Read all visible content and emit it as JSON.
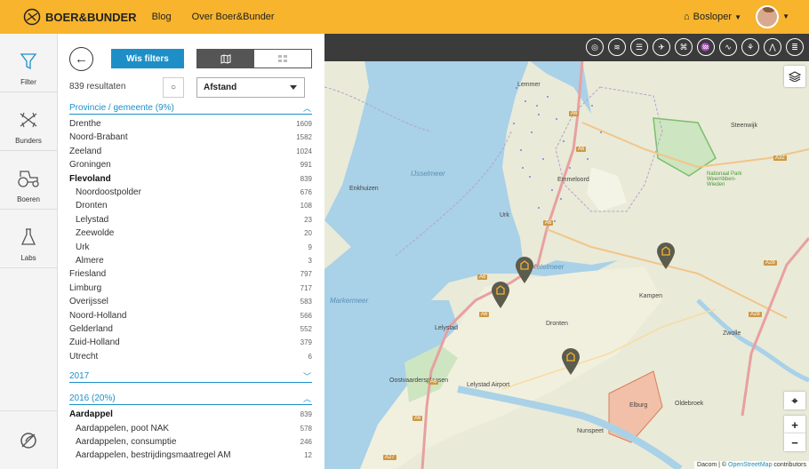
{
  "header": {
    "logo_text": "BOER&BUNDER",
    "nav": [
      "Blog",
      "Over Boer&Bunder"
    ],
    "user_name": "Bosloper"
  },
  "sidebar": {
    "items": [
      {
        "label": "Filter",
        "icon": "filter-icon"
      },
      {
        "label": "Bunders",
        "icon": "bunders-icon"
      },
      {
        "label": "Boeren",
        "icon": "tractor-icon"
      },
      {
        "label": "Labs",
        "icon": "flask-icon"
      }
    ]
  },
  "filters": {
    "clear_label": "Wis filters",
    "results": "839 resultaten",
    "sort_button": "○",
    "sort_value": "Afstand",
    "sections": [
      {
        "title": "Provincie / gemeente (9%)",
        "expanded": true,
        "rows": [
          {
            "label": "Drenthe",
            "count": "1609",
            "sub": false,
            "bold": false
          },
          {
            "label": "Noord-Brabant",
            "count": "1582",
            "sub": false,
            "bold": false
          },
          {
            "label": "Zeeland",
            "count": "1024",
            "sub": false,
            "bold": false
          },
          {
            "label": "Groningen",
            "count": "991",
            "sub": false,
            "bold": false
          },
          {
            "label": "Flevoland",
            "count": "839",
            "sub": false,
            "bold": true
          },
          {
            "label": "Noordoostpolder",
            "count": "676",
            "sub": true,
            "bold": false
          },
          {
            "label": "Dronten",
            "count": "108",
            "sub": true,
            "bold": false
          },
          {
            "label": "Lelystad",
            "count": "23",
            "sub": true,
            "bold": false
          },
          {
            "label": "Zeewolde",
            "count": "20",
            "sub": true,
            "bold": false
          },
          {
            "label": "Urk",
            "count": "9",
            "sub": true,
            "bold": false
          },
          {
            "label": "Almere",
            "count": "3",
            "sub": true,
            "bold": false
          },
          {
            "label": "Friesland",
            "count": "797",
            "sub": false,
            "bold": false
          },
          {
            "label": "Limburg",
            "count": "717",
            "sub": false,
            "bold": false
          },
          {
            "label": "Overijssel",
            "count": "583",
            "sub": false,
            "bold": false
          },
          {
            "label": "Noord-Holland",
            "count": "566",
            "sub": false,
            "bold": false
          },
          {
            "label": "Gelderland",
            "count": "552",
            "sub": false,
            "bold": false
          },
          {
            "label": "Zuid-Holland",
            "count": "379",
            "sub": false,
            "bold": false
          },
          {
            "label": "Utrecht",
            "count": "6",
            "sub": false,
            "bold": false
          }
        ]
      },
      {
        "title": "2017",
        "expanded": false,
        "rows": []
      },
      {
        "title": "2016 (20%)",
        "expanded": true,
        "rows": [
          {
            "label": "Aardappel",
            "count": "839",
            "sub": false,
            "bold": true
          },
          {
            "label": "Aardappelen, poot NAK",
            "count": "578",
            "sub": true,
            "bold": false
          },
          {
            "label": "Aardappelen, consumptie",
            "count": "246",
            "sub": true,
            "bold": false
          },
          {
            "label": "Aardappelen, bestrijdingsmaatregel AM",
            "count": "12",
            "sub": true,
            "bold": false
          }
        ]
      }
    ]
  },
  "map": {
    "labels": [
      "Lemmer",
      "Steenwijk",
      "Emmeloord",
      "IJsselmeer",
      "Enkhuizen",
      "Urk",
      "Nationaal Park Weerribben-Wieden",
      "Kampen",
      "Markermeer",
      "Lelystad",
      "Dronten",
      "Zwolle",
      "Lelystad Airport",
      "Oostvaardersplassen",
      "Elburg",
      "Oldebroek",
      "Nunspeet",
      "Ketelmeer"
    ],
    "roads": [
      "A6",
      "A6",
      "A6",
      "A6",
      "A32",
      "A28",
      "A28",
      "A6",
      "A6",
      "A6",
      "A27"
    ],
    "attribution_prefix": "Dacom | ©",
    "attribution_link": "OpenStreetMap",
    "attribution_suffix": "contributors",
    "pin_color": "#5b5b4e"
  }
}
